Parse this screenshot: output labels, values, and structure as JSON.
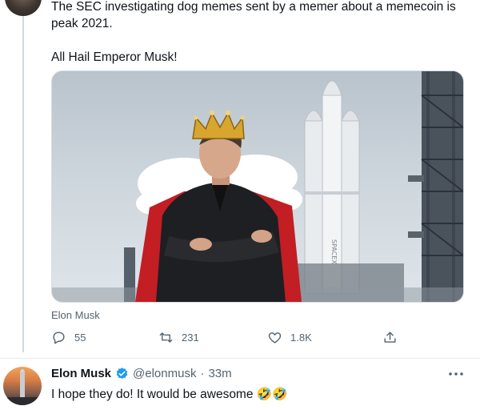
{
  "tweet": {
    "text": "The SEC investigating dog memes sent by a memer about a memecoin is\npeak 2021.\n\nAll Hail Emperor Musk!",
    "media_caption": "Elon Musk",
    "media_icon_names": [
      "crown",
      "musk-figure",
      "falcon-heavy-rocket",
      "launch-tower"
    ],
    "rocket_text": "SPACEX",
    "actions": {
      "reply_count": "55",
      "retweet_count": "231",
      "like_count": "1.8K"
    }
  },
  "reply": {
    "name": "Elon Musk",
    "handle": "@elonmusk",
    "separator": "·",
    "time": "33m",
    "text": "I hope they do! It would be awesome 🤣🤣"
  },
  "colors": {
    "text": "#0f1419",
    "muted": "#536471",
    "verified": "#1d9bf0",
    "border": "#e6ecf0"
  }
}
